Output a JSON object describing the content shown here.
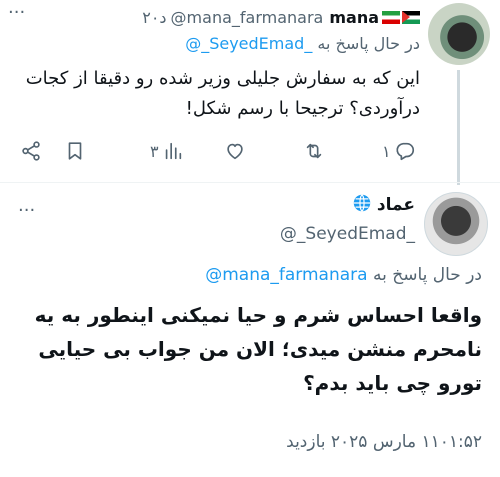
{
  "tweet1": {
    "name": "mana",
    "handle": "@mana_farmanara",
    "time": "۲۰د",
    "more": "···",
    "reply_prefix": "در حال پاسخ به",
    "reply_target": "@_SeyedEmad_",
    "body": "این که به سفارش جلیلی وزیر شده رو دقیقا از کجات درآوردی؟ ترجیحا با رسم شکل!",
    "actions": {
      "reply_count": "۱",
      "retweet_count": "",
      "like_count": "",
      "views_count": "۳"
    }
  },
  "tweet2": {
    "name": "عماد",
    "handle": "@_SeyedEmad_",
    "more": "···",
    "reply_prefix": "در حال پاسخ به",
    "reply_target": "@mana_farmanara",
    "body": "واقعا احساس شرم و حیا نمیکنی اینطور به یه نامحرم منشن میدی؛ الان من جواب بی حیایی تورو چی باید بدم؟",
    "meta": "۱۱۰۱:۵۲ مارس ۲۰۲۵ بازدید"
  }
}
